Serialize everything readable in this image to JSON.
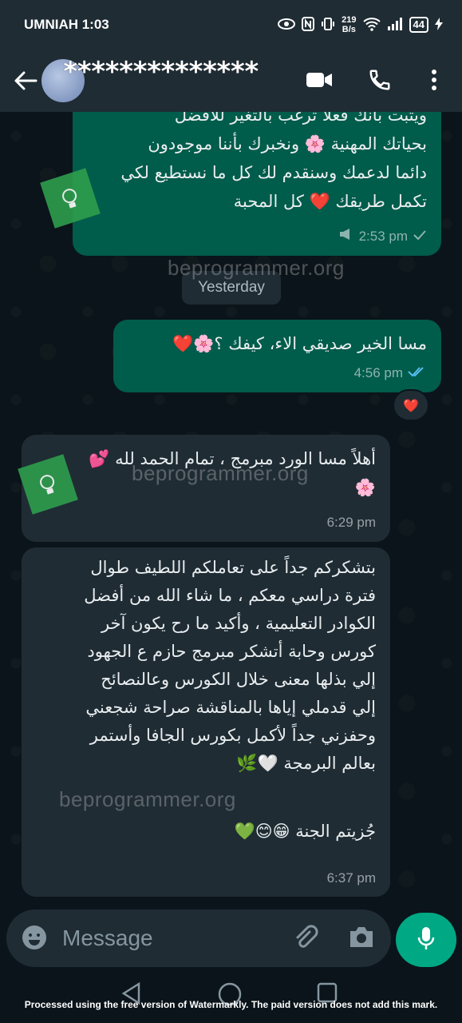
{
  "status_bar": {
    "carrier_time": "UMNIAH 1:03",
    "speed_value": "219",
    "speed_unit": "B/s",
    "battery": "44"
  },
  "header": {
    "contact_name": "**************"
  },
  "messages": {
    "m1": {
      "lines": [
        "ويثبت بأنك فعلا ترغب بالتغير للأفضل",
        "بحياتك المهنية 🌸 ونخبرك بأننا موجودون",
        "دائما لدعمك وسنقدم لك كل ما نستطيع لكي",
        "تكمل طريقك ❤️ كل المحبة"
      ],
      "time": "2:53 pm"
    },
    "date_chip": "Yesterday",
    "m2": {
      "text": "مسا الخير صديقي الاء، كيفك ؟🌸❤️",
      "time": "4:56 pm",
      "reaction": "❤️"
    },
    "m3": {
      "lines": [
        "أهلاً مسا الورد مبرمج ، تمام الحمد لله 💕",
        "🌸"
      ],
      "time": "6:29 pm"
    },
    "m4": {
      "lines": [
        "بتشكركم جداً على تعاملكم اللطيف طوال",
        "فترة دراسي معكم ، ما شاء الله من أفضل",
        "الكوادر التعليمية ، وأكيد ما رح يكون آخر",
        "كورس وحابة أتشكر مبرمج حازم ع الجهود",
        "إلي بذلها معنى خلال الكورس وعالنصائح",
        "إلي قدملي إياها بالمناقشة صراحة شجعني",
        "وحفزني جداً لأكمل بكورس الجافا وأستمر",
        "بعالم البرمجة 🤍🌿"
      ],
      "closing": "جُزيتم الجنة 😁😊💚",
      "time": "6:37 pm"
    }
  },
  "watermarks": [
    "beprogrammer.org",
    "beprogrammer.org",
    "beprogrammer.org"
  ],
  "input": {
    "placeholder": "Message"
  },
  "footer_note": "Processed using the free version of Watermarkly. The paid version does not add this mark.",
  "colors": {
    "outgoing_bubble": "#005c4b",
    "incoming_bubble": "#1f2c34",
    "accent": "#00a884",
    "read_ticks": "#53bdeb"
  }
}
